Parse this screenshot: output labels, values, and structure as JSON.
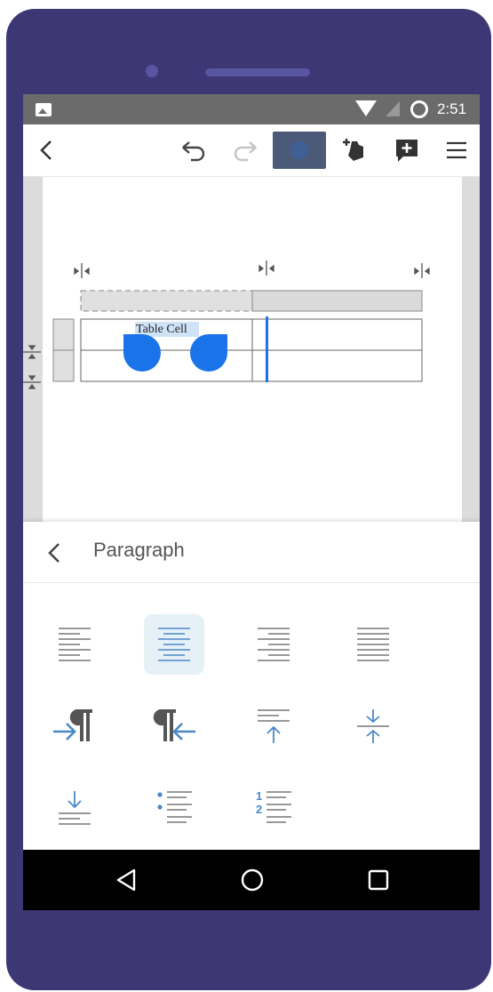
{
  "status_bar": {
    "time": "2:51",
    "icons": [
      "image-icon",
      "wifi-icon",
      "no-signal-icon",
      "battery-icon"
    ]
  },
  "toolbar": {
    "icons": [
      "back-icon",
      "undo-icon",
      "redo-icon",
      "mode-toggle-icon",
      "shape-add-icon",
      "comment-add-icon",
      "menu-icon"
    ]
  },
  "document": {
    "table_cell_text": "Table Cell"
  },
  "panel": {
    "title": "Paragraph",
    "buttons": [
      {
        "name": "align-left-icon",
        "selected": false
      },
      {
        "name": "align-center-icon",
        "selected": true
      },
      {
        "name": "align-right-icon",
        "selected": false
      },
      {
        "name": "align-justify-icon",
        "selected": false
      },
      {
        "name": "indent-increase-icon",
        "selected": false
      },
      {
        "name": "indent-decrease-icon",
        "selected": false
      },
      {
        "name": "spacing-before-icon",
        "selected": false
      },
      {
        "name": "spacing-collapse-icon",
        "selected": false
      },
      {
        "name": "spacing-after-icon",
        "selected": false
      },
      {
        "name": "bullet-list-icon",
        "selected": false
      },
      {
        "name": "numbered-list-icon",
        "selected": false
      }
    ]
  },
  "nav_bar": {
    "icons": [
      "nav-back-icon",
      "nav-home-icon",
      "nav-recents-icon"
    ]
  },
  "colors": {
    "frame": "#3d3776",
    "accent": "#1a73e8",
    "icon_blue": "#4a88c7",
    "status_bar": "#6b6b6b"
  }
}
